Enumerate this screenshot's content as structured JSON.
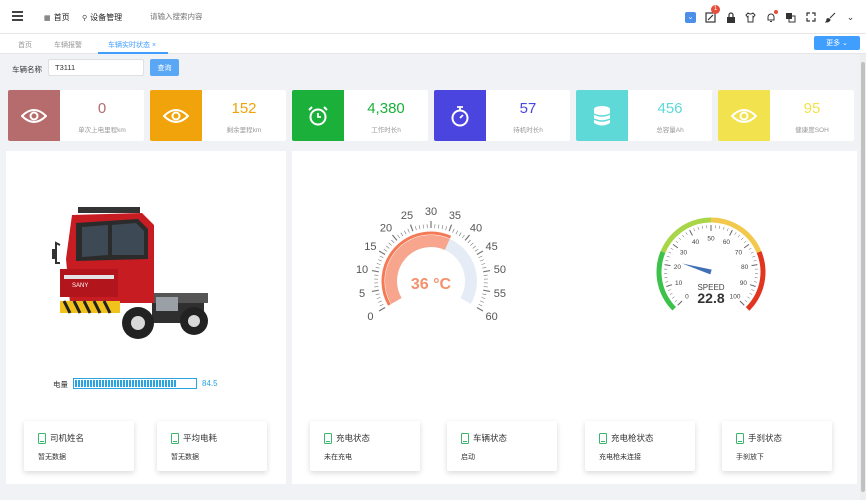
{
  "topbar": {
    "nav_home": "首页",
    "nav_device": "设备管理",
    "search_placeholder": "请输入搜索内容",
    "notification_count": "1"
  },
  "tabs": [
    {
      "label": "首页"
    },
    {
      "label": "车辆报警"
    },
    {
      "label": "车辆实时状态",
      "close": "×"
    }
  ],
  "more_button": "更多 ⌄",
  "query": {
    "label": "车辆名称",
    "value": "T3111",
    "button": "查询"
  },
  "stats": [
    {
      "value": "0",
      "label": "单次上电里程km",
      "icon": "eye-icon",
      "icon_bg": "#b66c6c",
      "value_color": "#b66c6c"
    },
    {
      "value": "152",
      "label": "剩余里程km",
      "icon": "eye-icon",
      "icon_bg": "#f0a30a",
      "value_color": "#f0a30a"
    },
    {
      "value": "4,380",
      "label": "工作时长h",
      "icon": "alarm-clock-icon",
      "icon_bg": "#1ab03a",
      "value_color": "#1ab03a"
    },
    {
      "value": "57",
      "label": "待机时长h",
      "icon": "stopwatch-icon",
      "icon_bg": "#4b45e0",
      "value_color": "#4b45e0"
    },
    {
      "value": "456",
      "label": "总容量Ah",
      "icon": "database-icon",
      "icon_bg": "#5fd8d8",
      "value_color": "#5fd8d8"
    },
    {
      "value": "95",
      "label": "健康度SOH",
      "icon": "eye-icon",
      "icon_bg": "#f2e24e",
      "value_color": "#f2e24e"
    }
  ],
  "battery": {
    "label": "电量",
    "value": "84.5",
    "fraction": 0.845
  },
  "left_cards": [
    {
      "title": "司机姓名",
      "value": "暂无数据"
    },
    {
      "title": "平均电耗",
      "value": "暂无数据"
    }
  ],
  "right_cards": [
    {
      "title": "充电状态",
      "value": "未在充电"
    },
    {
      "title": "车辆状态",
      "value": "启动"
    },
    {
      "title": "充电枪状态",
      "value": "充电枪未连接"
    },
    {
      "title": "手刹状态",
      "value": "手刹放下"
    }
  ],
  "temp_gauge": {
    "value": 36,
    "display": "36 °C",
    "min": 0,
    "max": 60,
    "ticks": [
      "0",
      "5",
      "10",
      "15",
      "20",
      "25",
      "30",
      "35",
      "40",
      "45",
      "50",
      "55",
      "60"
    ]
  },
  "speed_gauge": {
    "value": 22.8,
    "display": "22.8",
    "title": "SPEED",
    "min": 0,
    "max": 100,
    "ticks": [
      "0",
      "10",
      "20",
      "30",
      "40",
      "50",
      "60",
      "70",
      "80",
      "90",
      "100"
    ]
  }
}
